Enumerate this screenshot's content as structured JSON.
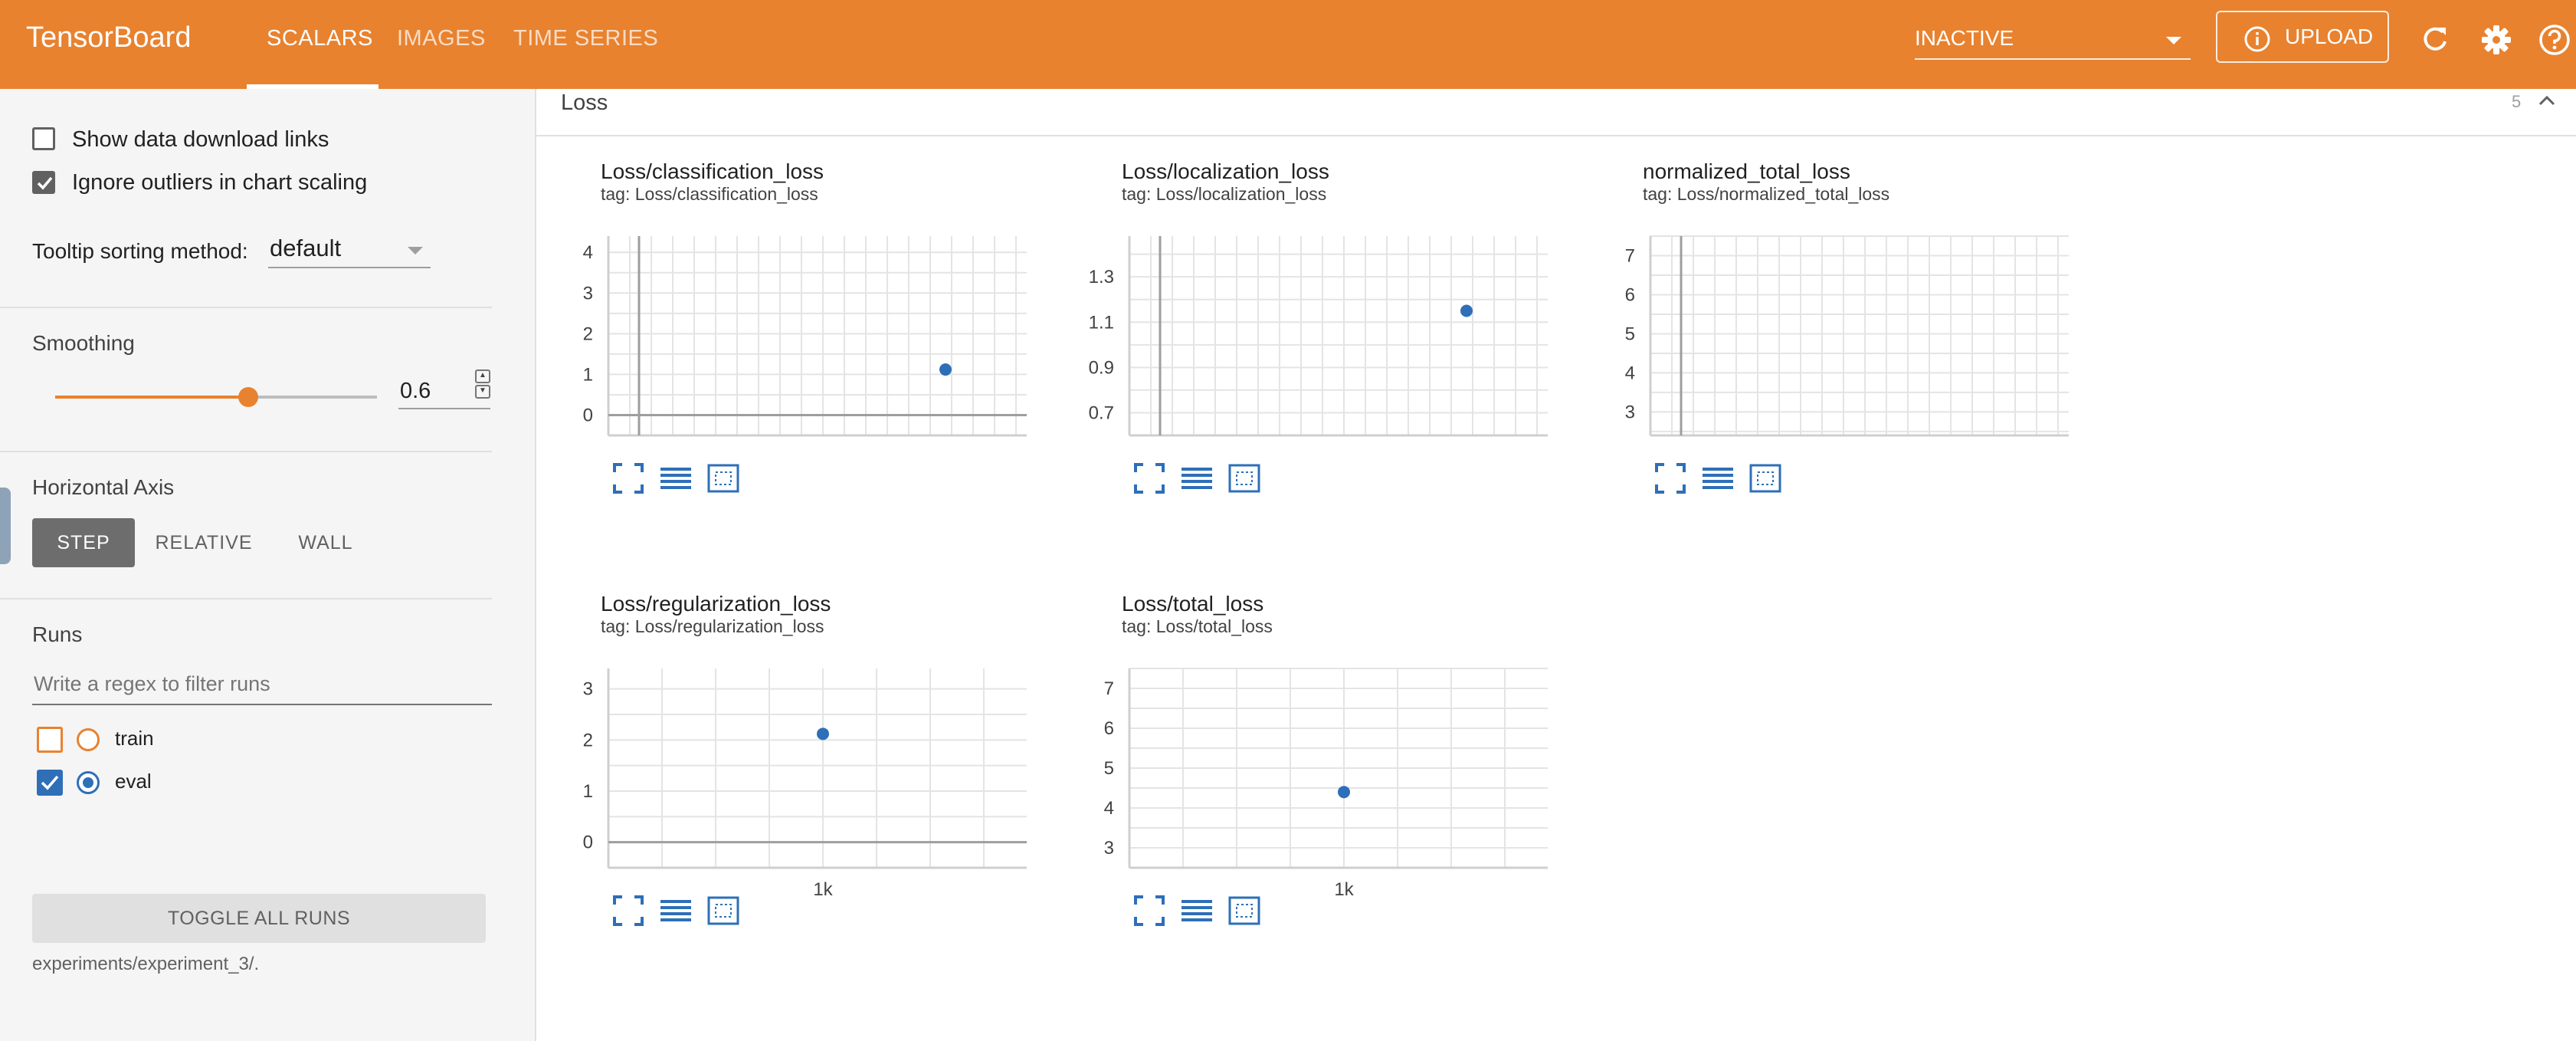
{
  "header": {
    "brand": "TensorBoard",
    "tabs": [
      {
        "label": "SCALARS",
        "active": true
      },
      {
        "label": "IMAGES",
        "active": false
      },
      {
        "label": "TIME SERIES",
        "active": false
      }
    ],
    "run_status": "INACTIVE",
    "upload_label": "UPLOAD",
    "accent_color": "#e8822f"
  },
  "sidebar": {
    "show_download_links": {
      "label": "Show data download links",
      "checked": false
    },
    "ignore_outliers": {
      "label": "Ignore outliers in chart scaling",
      "checked": true
    },
    "tooltip": {
      "label": "Tooltip sorting method:",
      "value": "default"
    },
    "smoothing": {
      "title": "Smoothing",
      "value": "0.6",
      "fraction": 0.6
    },
    "horizontal_axis": {
      "title": "Horizontal Axis",
      "options": [
        "STEP",
        "RELATIVE",
        "WALL"
      ],
      "selected": "STEP"
    },
    "runs": {
      "title": "Runs",
      "filter_placeholder": "Write a regex to filter runs",
      "items": [
        {
          "name": "train",
          "checked": false,
          "color": "#e8822f"
        },
        {
          "name": "eval",
          "checked": true,
          "color": "#2e6fb8"
        }
      ],
      "toggle_all_label": "TOGGLE ALL RUNS",
      "log_dir": "experiments/experiment_3/."
    }
  },
  "main": {
    "group_name": "Loss",
    "group_count": "5"
  },
  "chart_data": [
    {
      "type": "scatter",
      "title": "Loss/classification_loss",
      "subtitle": "tag: Loss/classification_loss",
      "yticks": [
        "4",
        "3",
        "2",
        "1",
        "0"
      ],
      "ylim": [
        -0.5,
        4.4
      ],
      "xticks": [],
      "series": [
        {
          "x": [
            1000
          ],
          "y": [
            1.12
          ]
        }
      ],
      "color": "#2e6fb8"
    },
    {
      "type": "scatter",
      "title": "Loss/localization_loss",
      "subtitle": "tag: Loss/localization_loss",
      "yticks": [
        "1.3",
        "1.1",
        "0.9",
        "0.7"
      ],
      "ylim": [
        0.6,
        1.48
      ],
      "xticks": [],
      "series": [
        {
          "x": [
            1000
          ],
          "y": [
            1.15
          ]
        }
      ],
      "color": "#2e6fb8"
    },
    {
      "type": "scatter",
      "title": "normalized_total_loss",
      "subtitle": "tag: Loss/normalized_total_loss",
      "yticks": [
        "7",
        "6",
        "5",
        "4",
        "3"
      ],
      "ylim": [
        2.4,
        7.5
      ],
      "xticks": [],
      "series": [],
      "color": "#2e6fb8"
    },
    {
      "type": "scatter",
      "title": "Loss/regularization_loss",
      "subtitle": "tag: Loss/regularization_loss",
      "yticks": [
        "3",
        "2",
        "1",
        "0"
      ],
      "ylim": [
        -0.5,
        3.4
      ],
      "xticks": [
        "1k"
      ],
      "series": [
        {
          "x": [
            1000
          ],
          "y": [
            2.12
          ]
        }
      ],
      "color": "#2e6fb8"
    },
    {
      "type": "scatter",
      "title": "Loss/total_loss",
      "subtitle": "tag: Loss/total_loss",
      "yticks": [
        "7",
        "6",
        "5",
        "4",
        "3"
      ],
      "ylim": [
        2.5,
        7.5
      ],
      "xticks": [
        "1k"
      ],
      "series": [
        {
          "x": [
            1000
          ],
          "y": [
            4.4
          ]
        }
      ],
      "color": "#2e6fb8"
    }
  ]
}
